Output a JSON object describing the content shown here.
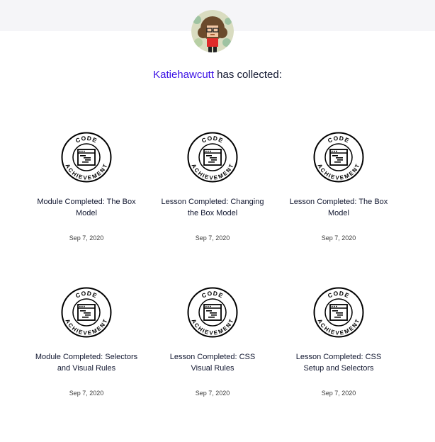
{
  "profile": {
    "username": "Katiehawcutt",
    "collected_text": " has collected:"
  },
  "achievements": [
    {
      "badge_top": "CODE",
      "badge_bottom": "ACHIEVEMENT",
      "title": "Module Completed: The Box Model",
      "date": "Sep 7, 2020"
    },
    {
      "badge_top": "CODE",
      "badge_bottom": "ACHIEVEMENT",
      "title": "Lesson Completed: Changing the Box Model",
      "date": "Sep 7, 2020"
    },
    {
      "badge_top": "CODE",
      "badge_bottom": "ACHIEVEMENT",
      "title": "Lesson Completed: The Box Model",
      "date": "Sep 7, 2020"
    },
    {
      "badge_top": "CODE",
      "badge_bottom": "ACHIEVEMENT",
      "title": "Module Completed: Selectors and Visual Rules",
      "date": "Sep 7, 2020"
    },
    {
      "badge_top": "CODE",
      "badge_bottom": "ACHIEVEMENT",
      "title": "Lesson Completed: CSS Visual Rules",
      "date": "Sep 7, 2020"
    },
    {
      "badge_top": "CODE",
      "badge_bottom": "ACHIEVEMENT",
      "title": "Lesson Completed: CSS Setup and Selectors",
      "date": "Sep 7, 2020"
    }
  ],
  "colors": {
    "header_band": "#f5f5f8",
    "username_link": "#3a10e5",
    "text": "#10162f"
  },
  "icons": {
    "badge": "code-achievement-badge-icon"
  }
}
